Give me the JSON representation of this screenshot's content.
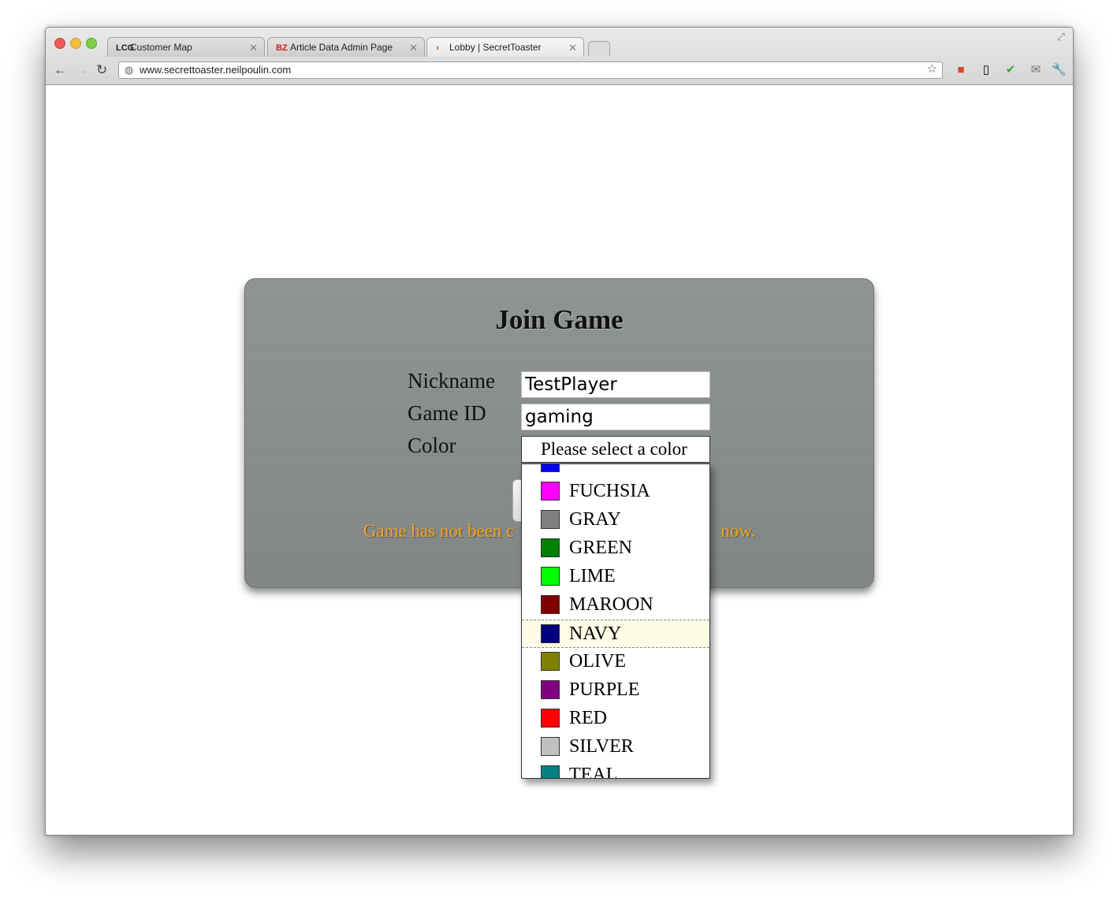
{
  "browser": {
    "tabs": [
      {
        "favicon": "LCG",
        "title": "Customer Map",
        "active": false
      },
      {
        "favicon": "BZ",
        "title": "Article Data Admin Page",
        "active": false
      },
      {
        "favicon": "toaster-icon",
        "title": "Lobby | SecretToaster",
        "active": true
      }
    ],
    "url": "www.secrettoaster.neilpoulin.com"
  },
  "form": {
    "title": "Join Game",
    "nickname_label": "Nickname",
    "nickname_value": "TestPlayer",
    "gameid_label": "Game ID",
    "gameid_value": "gaming",
    "color_label": "Color",
    "color_selected": "Please select a color",
    "status_message": "Game has not been c",
    "status_message_end": "now."
  },
  "color_options": [
    {
      "name": "",
      "hex": "#0000ff"
    },
    {
      "name": "FUCHSIA",
      "hex": "#ff00ff"
    },
    {
      "name": "GRAY",
      "hex": "#808080"
    },
    {
      "name": "GREEN",
      "hex": "#008000"
    },
    {
      "name": "LIME",
      "hex": "#00ff00"
    },
    {
      "name": "MAROON",
      "hex": "#800000"
    },
    {
      "name": "NAVY",
      "hex": "#000080",
      "highlighted": true
    },
    {
      "name": "OLIVE",
      "hex": "#808000"
    },
    {
      "name": "PURPLE",
      "hex": "#800080"
    },
    {
      "name": "RED",
      "hex": "#ff0000"
    },
    {
      "name": "SILVER",
      "hex": "#c0c0c0"
    },
    {
      "name": "TEAL",
      "hex": "#008080"
    }
  ]
}
